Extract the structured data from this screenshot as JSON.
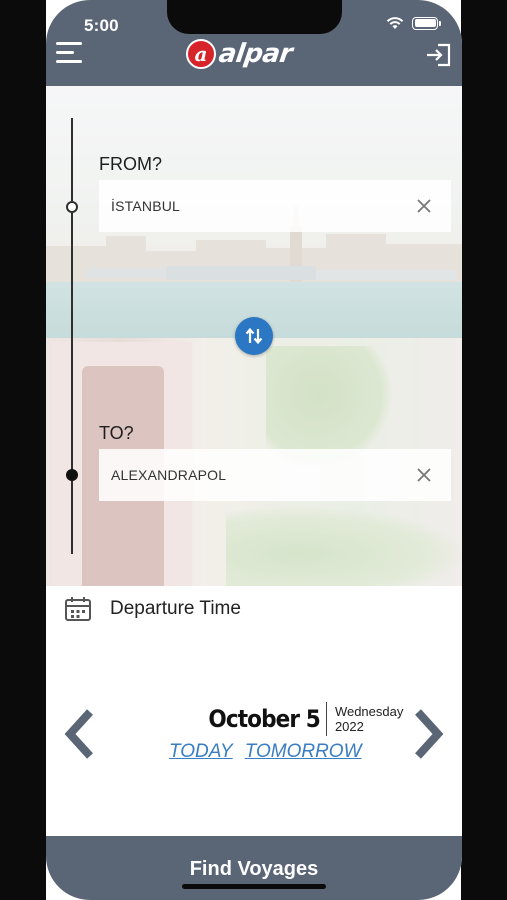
{
  "status_bar": {
    "time": "5:00"
  },
  "header": {
    "logo_mark": "a",
    "logo_text": "alpar",
    "brand_color": "#d7232a",
    "bar_color": "#5a6576"
  },
  "route": {
    "from_label": "FROM?",
    "from_value": "İSTANBUL",
    "to_label": "TO?",
    "to_value": "ALEXANDRAPOL",
    "swap_icon": "swap-vertical-icon"
  },
  "departure": {
    "label": "Departure Time",
    "date_main": "October 5",
    "weekday": "Wednesday",
    "year": "2022",
    "quick": [
      "TODAY",
      "TOMORROW"
    ],
    "accent_color": "#2b77c3"
  },
  "footer": {
    "button_label": "Find Voyages"
  }
}
